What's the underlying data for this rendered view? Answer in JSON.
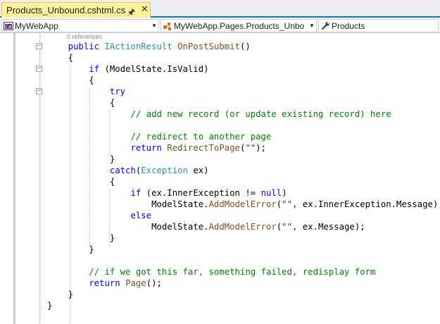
{
  "tab": {
    "title": "Products_Unbound.cshtml.cs",
    "pin_icon": "pin-icon",
    "close_icon": "close-icon"
  },
  "navbar": {
    "project": "MyWebApp",
    "type": "MyWebApp.Pages.Products_Unbo",
    "member": "Products"
  },
  "editor": {
    "references": "0 references",
    "lines": [
      [
        [
          "    ",
          "pr"
        ],
        [
          "public",
          "kw"
        ],
        [
          " ",
          "pr"
        ],
        [
          "IActionResult",
          "ty"
        ],
        [
          " ",
          "pr"
        ],
        [
          "OnPostSubmit",
          "mt"
        ],
        [
          "()",
          "pr"
        ]
      ],
      [
        [
          "    {",
          "pr"
        ]
      ],
      [
        [
          "        ",
          "pr"
        ],
        [
          "if",
          "kw"
        ],
        [
          " (ModelState.IsValid)",
          "pr"
        ]
      ],
      [
        [
          "        {",
          "pr"
        ]
      ],
      [
        [
          "            ",
          "pr"
        ],
        [
          "try",
          "kw"
        ]
      ],
      [
        [
          "            {",
          "pr"
        ]
      ],
      [
        [
          "                ",
          "pr"
        ],
        [
          "// add new record (or update existing record) here",
          "cm"
        ]
      ],
      [
        [
          "",
          "pr"
        ]
      ],
      [
        [
          "                ",
          "pr"
        ],
        [
          "// redirect to another page",
          "cm"
        ]
      ],
      [
        [
          "                ",
          "pr"
        ],
        [
          "return",
          "kw"
        ],
        [
          " ",
          "pr"
        ],
        [
          "RedirectToPage",
          "mt"
        ],
        [
          "(",
          "pr"
        ],
        [
          "\"\"",
          "st"
        ],
        [
          ");",
          "pr"
        ]
      ],
      [
        [
          "            }",
          "pr"
        ]
      ],
      [
        [
          "            ",
          "pr"
        ],
        [
          "catch",
          "kw"
        ],
        [
          "(",
          "pr"
        ],
        [
          "Exception",
          "ty"
        ],
        [
          " ex)",
          "pr"
        ]
      ],
      [
        [
          "            {",
          "pr"
        ]
      ],
      [
        [
          "                ",
          "pr"
        ],
        [
          "if",
          "kw"
        ],
        [
          " (ex.InnerException != ",
          "pr"
        ],
        [
          "null",
          "kw"
        ],
        [
          ")",
          "pr"
        ]
      ],
      [
        [
          "                    ModelState.",
          "pr"
        ],
        [
          "AddModelError",
          "mt"
        ],
        [
          "(",
          "pr"
        ],
        [
          "\"\"",
          "st"
        ],
        [
          ", ex.InnerException.Message);",
          "pr"
        ]
      ],
      [
        [
          "                ",
          "pr"
        ],
        [
          "else",
          "kw"
        ]
      ],
      [
        [
          "                    ModelState.",
          "pr"
        ],
        [
          "AddModelError",
          "mt"
        ],
        [
          "(",
          "pr"
        ],
        [
          "\"\"",
          "st"
        ],
        [
          ", ex.Message);",
          "pr"
        ]
      ],
      [
        [
          "            }",
          "pr"
        ]
      ],
      [
        [
          "        }",
          "pr"
        ]
      ],
      [
        [
          "",
          "pr"
        ]
      ],
      [
        [
          "        ",
          "pr"
        ],
        [
          "// if we got this far, something failed, redisplay form",
          "cm"
        ]
      ],
      [
        [
          "        ",
          "pr"
        ],
        [
          "return",
          "kw"
        ],
        [
          " ",
          "pr"
        ],
        [
          "Page",
          "mt"
        ],
        [
          "();",
          "pr"
        ]
      ],
      [
        [
          "    }",
          "pr"
        ]
      ],
      [
        [
          "}",
          "pr"
        ]
      ]
    ]
  },
  "colors": {
    "keyword": "#0000ff",
    "type": "#2b91af",
    "comment": "#008000",
    "string": "#a31515",
    "method": "#74531f",
    "tab_active": "#fff29d",
    "accent": "#007acc"
  }
}
